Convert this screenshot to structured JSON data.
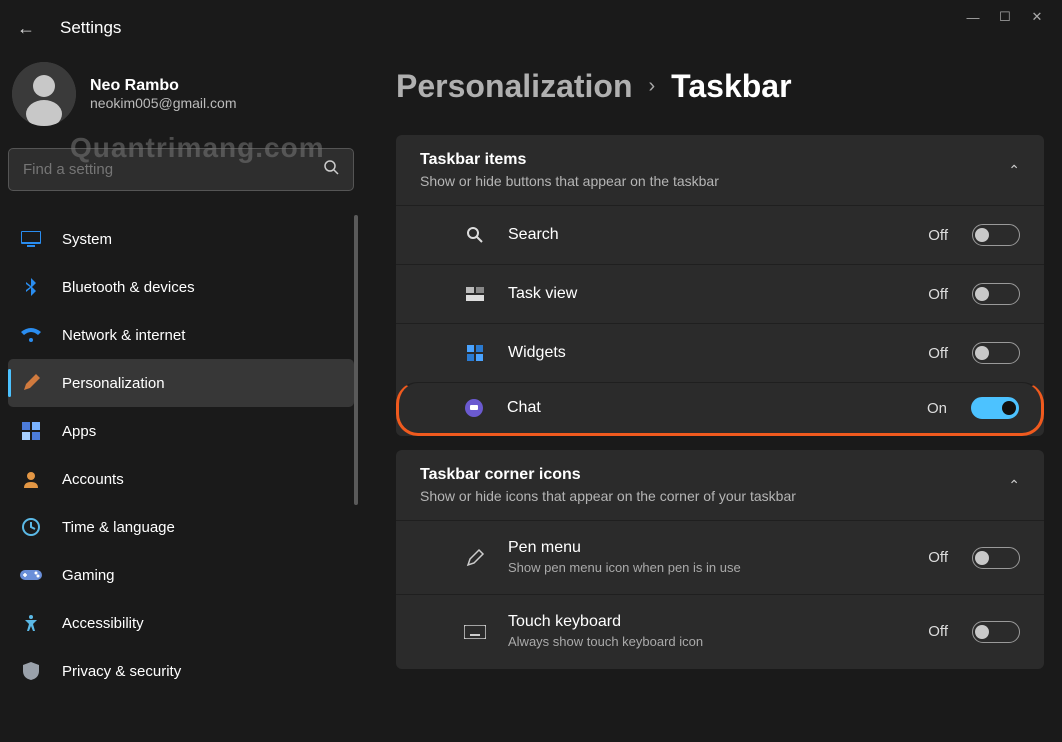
{
  "window": {
    "title": "Settings"
  },
  "user": {
    "name": "Neo Rambo",
    "email": "neokim005@gmail.com"
  },
  "watermark": "Quantrimang.com",
  "search": {
    "placeholder": "Find a setting"
  },
  "nav": [
    {
      "label": "System",
      "icon": "system-icon",
      "color": "#2a8df0"
    },
    {
      "label": "Bluetooth & devices",
      "icon": "bluetooth-icon",
      "color": "#2a8df0"
    },
    {
      "label": "Network & internet",
      "icon": "network-icon",
      "color": "#2a8df0"
    },
    {
      "label": "Personalization",
      "icon": "personalization-icon",
      "color": "#d07a3e",
      "active": true
    },
    {
      "label": "Apps",
      "icon": "apps-icon",
      "color": "#4c7bd9"
    },
    {
      "label": "Accounts",
      "icon": "accounts-icon",
      "color": "#e29644"
    },
    {
      "label": "Time & language",
      "icon": "time-icon",
      "color": "#5bb9e6"
    },
    {
      "label": "Gaming",
      "icon": "gaming-icon",
      "color": "#6a8fd9"
    },
    {
      "label": "Accessibility",
      "icon": "accessibility-icon",
      "color": "#5bb9e6"
    },
    {
      "label": "Privacy & security",
      "icon": "privacy-icon",
      "color": "#9aa1aa"
    }
  ],
  "breadcrumb": {
    "parent": "Personalization",
    "current": "Taskbar"
  },
  "sections": [
    {
      "title": "Taskbar items",
      "subtitle": "Show or hide buttons that appear on the taskbar",
      "items": [
        {
          "label": "Search",
          "state": "Off",
          "on": false,
          "icon": "search-icon"
        },
        {
          "label": "Task view",
          "state": "Off",
          "on": false,
          "icon": "taskview-icon"
        },
        {
          "label": "Widgets",
          "state": "Off",
          "on": false,
          "icon": "widgets-icon"
        },
        {
          "label": "Chat",
          "state": "On",
          "on": true,
          "icon": "chat-icon",
          "highlight": true
        }
      ]
    },
    {
      "title": "Taskbar corner icons",
      "subtitle": "Show or hide icons that appear on the corner of your taskbar",
      "items": [
        {
          "label": "Pen menu",
          "sub": "Show pen menu icon when pen is in use",
          "state": "Off",
          "on": false,
          "icon": "pen-icon"
        },
        {
          "label": "Touch keyboard",
          "sub": "Always show touch keyboard icon",
          "state": "Off",
          "on": false,
          "icon": "keyboard-icon"
        }
      ]
    }
  ]
}
